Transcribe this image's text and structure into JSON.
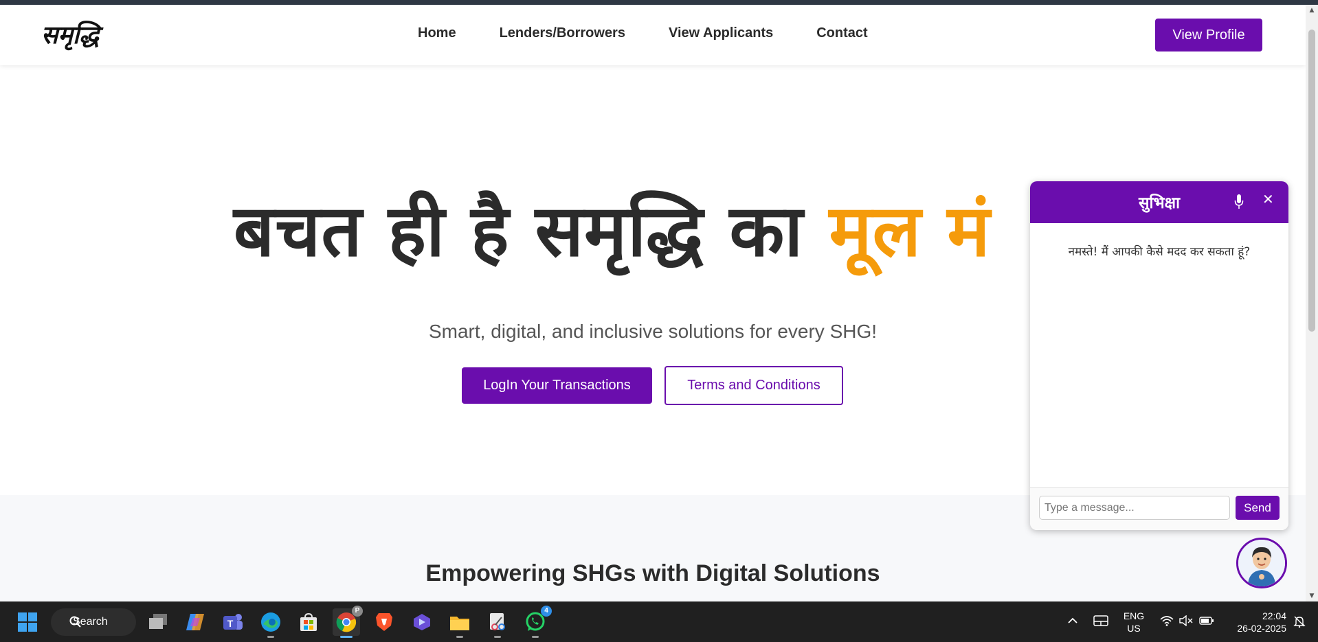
{
  "header": {
    "logo": "समृद्धि",
    "nav": [
      "Home",
      "Lenders/Borrowers",
      "View Applicants",
      "Contact"
    ],
    "profile_button": "View Profile"
  },
  "hero": {
    "title_main": "बचत ही है समृद्धि का ",
    "title_accent": "मूल मं",
    "subtitle": "Smart, digital, and inclusive solutions for every SHG!",
    "primary_button": "LogIn Your Transactions",
    "secondary_button": "Terms and Conditions"
  },
  "features": {
    "title": "Empowering SHGs with Digital Solutions"
  },
  "chat": {
    "title": "सुभिक्षा",
    "welcome_message": "नमस्ते! मैं आपकी कैसे मदद कर सकता हूं?",
    "input_placeholder": "Type a message...",
    "send_label": "Send",
    "mic_icon": "microphone-icon",
    "close_icon": "close-icon",
    "close_glyph": "✕"
  },
  "taskbar": {
    "search_label": "Search",
    "language_line1": "ENG",
    "language_line2": "US",
    "time": "22:04",
    "date": "26-02-2025",
    "chrome_badge": "P",
    "whatsapp_badge": "4"
  },
  "colors": {
    "brand_purple": "#6a0dad",
    "accent_orange": "#f59b0b"
  }
}
